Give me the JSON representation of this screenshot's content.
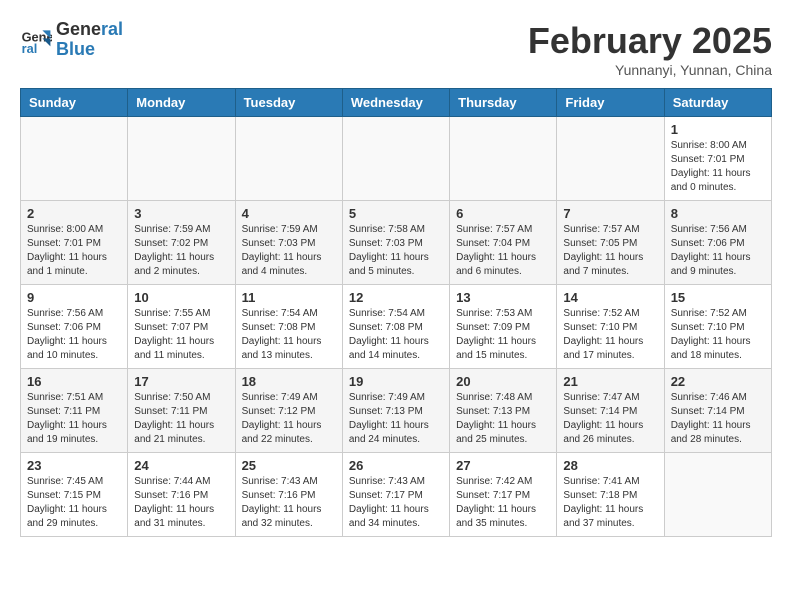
{
  "logo": {
    "text_general": "General",
    "text_blue": "Blue"
  },
  "header": {
    "title": "February 2025",
    "subtitle": "Yunnanyi, Yunnan, China"
  },
  "weekdays": [
    "Sunday",
    "Monday",
    "Tuesday",
    "Wednesday",
    "Thursday",
    "Friday",
    "Saturday"
  ],
  "weeks": [
    {
      "days": [
        {
          "num": "",
          "info": ""
        },
        {
          "num": "",
          "info": ""
        },
        {
          "num": "",
          "info": ""
        },
        {
          "num": "",
          "info": ""
        },
        {
          "num": "",
          "info": ""
        },
        {
          "num": "",
          "info": ""
        },
        {
          "num": "1",
          "info": "Sunrise: 8:00 AM\nSunset: 7:01 PM\nDaylight: 11 hours\nand 0 minutes."
        }
      ]
    },
    {
      "days": [
        {
          "num": "2",
          "info": "Sunrise: 8:00 AM\nSunset: 7:01 PM\nDaylight: 11 hours\nand 1 minute."
        },
        {
          "num": "3",
          "info": "Sunrise: 7:59 AM\nSunset: 7:02 PM\nDaylight: 11 hours\nand 2 minutes."
        },
        {
          "num": "4",
          "info": "Sunrise: 7:59 AM\nSunset: 7:03 PM\nDaylight: 11 hours\nand 4 minutes."
        },
        {
          "num": "5",
          "info": "Sunrise: 7:58 AM\nSunset: 7:03 PM\nDaylight: 11 hours\nand 5 minutes."
        },
        {
          "num": "6",
          "info": "Sunrise: 7:57 AM\nSunset: 7:04 PM\nDaylight: 11 hours\nand 6 minutes."
        },
        {
          "num": "7",
          "info": "Sunrise: 7:57 AM\nSunset: 7:05 PM\nDaylight: 11 hours\nand 7 minutes."
        },
        {
          "num": "8",
          "info": "Sunrise: 7:56 AM\nSunset: 7:06 PM\nDaylight: 11 hours\nand 9 minutes."
        }
      ]
    },
    {
      "days": [
        {
          "num": "9",
          "info": "Sunrise: 7:56 AM\nSunset: 7:06 PM\nDaylight: 11 hours\nand 10 minutes."
        },
        {
          "num": "10",
          "info": "Sunrise: 7:55 AM\nSunset: 7:07 PM\nDaylight: 11 hours\nand 11 minutes."
        },
        {
          "num": "11",
          "info": "Sunrise: 7:54 AM\nSunset: 7:08 PM\nDaylight: 11 hours\nand 13 minutes."
        },
        {
          "num": "12",
          "info": "Sunrise: 7:54 AM\nSunset: 7:08 PM\nDaylight: 11 hours\nand 14 minutes."
        },
        {
          "num": "13",
          "info": "Sunrise: 7:53 AM\nSunset: 7:09 PM\nDaylight: 11 hours\nand 15 minutes."
        },
        {
          "num": "14",
          "info": "Sunrise: 7:52 AM\nSunset: 7:10 PM\nDaylight: 11 hours\nand 17 minutes."
        },
        {
          "num": "15",
          "info": "Sunrise: 7:52 AM\nSunset: 7:10 PM\nDaylight: 11 hours\nand 18 minutes."
        }
      ]
    },
    {
      "days": [
        {
          "num": "16",
          "info": "Sunrise: 7:51 AM\nSunset: 7:11 PM\nDaylight: 11 hours\nand 19 minutes."
        },
        {
          "num": "17",
          "info": "Sunrise: 7:50 AM\nSunset: 7:11 PM\nDaylight: 11 hours\nand 21 minutes."
        },
        {
          "num": "18",
          "info": "Sunrise: 7:49 AM\nSunset: 7:12 PM\nDaylight: 11 hours\nand 22 minutes."
        },
        {
          "num": "19",
          "info": "Sunrise: 7:49 AM\nSunset: 7:13 PM\nDaylight: 11 hours\nand 24 minutes."
        },
        {
          "num": "20",
          "info": "Sunrise: 7:48 AM\nSunset: 7:13 PM\nDaylight: 11 hours\nand 25 minutes."
        },
        {
          "num": "21",
          "info": "Sunrise: 7:47 AM\nSunset: 7:14 PM\nDaylight: 11 hours\nand 26 minutes."
        },
        {
          "num": "22",
          "info": "Sunrise: 7:46 AM\nSunset: 7:14 PM\nDaylight: 11 hours\nand 28 minutes."
        }
      ]
    },
    {
      "days": [
        {
          "num": "23",
          "info": "Sunrise: 7:45 AM\nSunset: 7:15 PM\nDaylight: 11 hours\nand 29 minutes."
        },
        {
          "num": "24",
          "info": "Sunrise: 7:44 AM\nSunset: 7:16 PM\nDaylight: 11 hours\nand 31 minutes."
        },
        {
          "num": "25",
          "info": "Sunrise: 7:43 AM\nSunset: 7:16 PM\nDaylight: 11 hours\nand 32 minutes."
        },
        {
          "num": "26",
          "info": "Sunrise: 7:43 AM\nSunset: 7:17 PM\nDaylight: 11 hours\nand 34 minutes."
        },
        {
          "num": "27",
          "info": "Sunrise: 7:42 AM\nSunset: 7:17 PM\nDaylight: 11 hours\nand 35 minutes."
        },
        {
          "num": "28",
          "info": "Sunrise: 7:41 AM\nSunset: 7:18 PM\nDaylight: 11 hours\nand 37 minutes."
        },
        {
          "num": "",
          "info": ""
        }
      ]
    }
  ]
}
